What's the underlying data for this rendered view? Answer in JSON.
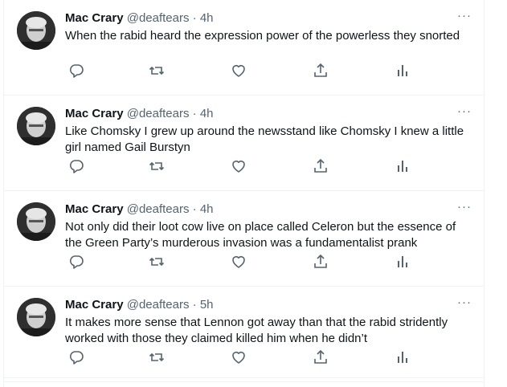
{
  "tweets": [
    {
      "name": "Mac Crary",
      "handle": "@deaftears",
      "separator": "·",
      "time": "4h",
      "more": "···",
      "text": "When the rabid heard the expression power of the powerless they snorted",
      "top": 0
    },
    {
      "name": "Mac Crary",
      "handle": "@deaftears",
      "separator": "·",
      "time": "4h",
      "more": "···",
      "text": "Like Chomsky I grew up around the newsstand like Chomsky I knew a little girl named Gail Burstyn"
    },
    {
      "name": "Mac Crary",
      "handle": "@deaftears",
      "separator": "·",
      "time": "4h",
      "more": "···",
      "text": "Not only did their loot cow live on place called Celeron but the essence of the Green Party’s murderous invasion was a fundamentalist prank"
    },
    {
      "name": "Mac Crary",
      "handle": "@deaftears",
      "separator": "·",
      "time": "5h",
      "more": "···",
      "text": "It makes more sense that Lennon got away than that the rabid stridently worked with those they claimed killed him when he didn’t"
    }
  ],
  "icons": {
    "reply": "reply-icon",
    "retweet": "retweet-icon",
    "like": "like-icon",
    "share": "share-icon",
    "analytics": "analytics-icon"
  },
  "colors": {
    "text": "#0f1419",
    "secondary": "#536471",
    "border": "#eff3f4"
  }
}
